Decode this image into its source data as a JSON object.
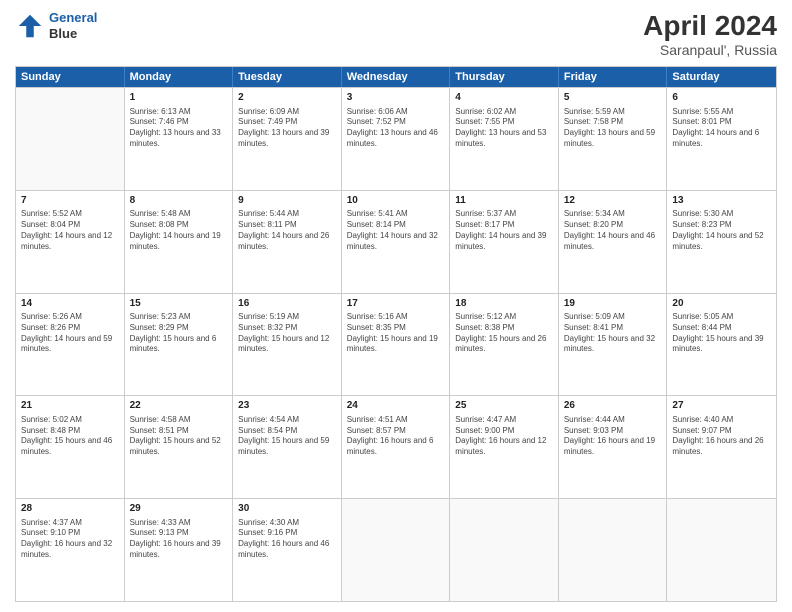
{
  "header": {
    "logo_line1": "General",
    "logo_line2": "Blue",
    "title": "April 2024",
    "location": "Saranpaul', Russia"
  },
  "weekdays": [
    "Sunday",
    "Monday",
    "Tuesday",
    "Wednesday",
    "Thursday",
    "Friday",
    "Saturday"
  ],
  "weeks": [
    [
      {
        "day": "",
        "sunrise": "",
        "sunset": "",
        "daylight": ""
      },
      {
        "day": "1",
        "sunrise": "Sunrise: 6:13 AM",
        "sunset": "Sunset: 7:46 PM",
        "daylight": "Daylight: 13 hours and 33 minutes."
      },
      {
        "day": "2",
        "sunrise": "Sunrise: 6:09 AM",
        "sunset": "Sunset: 7:49 PM",
        "daylight": "Daylight: 13 hours and 39 minutes."
      },
      {
        "day": "3",
        "sunrise": "Sunrise: 6:06 AM",
        "sunset": "Sunset: 7:52 PM",
        "daylight": "Daylight: 13 hours and 46 minutes."
      },
      {
        "day": "4",
        "sunrise": "Sunrise: 6:02 AM",
        "sunset": "Sunset: 7:55 PM",
        "daylight": "Daylight: 13 hours and 53 minutes."
      },
      {
        "day": "5",
        "sunrise": "Sunrise: 5:59 AM",
        "sunset": "Sunset: 7:58 PM",
        "daylight": "Daylight: 13 hours and 59 minutes."
      },
      {
        "day": "6",
        "sunrise": "Sunrise: 5:55 AM",
        "sunset": "Sunset: 8:01 PM",
        "daylight": "Daylight: 14 hours and 6 minutes."
      }
    ],
    [
      {
        "day": "7",
        "sunrise": "Sunrise: 5:52 AM",
        "sunset": "Sunset: 8:04 PM",
        "daylight": "Daylight: 14 hours and 12 minutes."
      },
      {
        "day": "8",
        "sunrise": "Sunrise: 5:48 AM",
        "sunset": "Sunset: 8:08 PM",
        "daylight": "Daylight: 14 hours and 19 minutes."
      },
      {
        "day": "9",
        "sunrise": "Sunrise: 5:44 AM",
        "sunset": "Sunset: 8:11 PM",
        "daylight": "Daylight: 14 hours and 26 minutes."
      },
      {
        "day": "10",
        "sunrise": "Sunrise: 5:41 AM",
        "sunset": "Sunset: 8:14 PM",
        "daylight": "Daylight: 14 hours and 32 minutes."
      },
      {
        "day": "11",
        "sunrise": "Sunrise: 5:37 AM",
        "sunset": "Sunset: 8:17 PM",
        "daylight": "Daylight: 14 hours and 39 minutes."
      },
      {
        "day": "12",
        "sunrise": "Sunrise: 5:34 AM",
        "sunset": "Sunset: 8:20 PM",
        "daylight": "Daylight: 14 hours and 46 minutes."
      },
      {
        "day": "13",
        "sunrise": "Sunrise: 5:30 AM",
        "sunset": "Sunset: 8:23 PM",
        "daylight": "Daylight: 14 hours and 52 minutes."
      }
    ],
    [
      {
        "day": "14",
        "sunrise": "Sunrise: 5:26 AM",
        "sunset": "Sunset: 8:26 PM",
        "daylight": "Daylight: 14 hours and 59 minutes."
      },
      {
        "day": "15",
        "sunrise": "Sunrise: 5:23 AM",
        "sunset": "Sunset: 8:29 PM",
        "daylight": "Daylight: 15 hours and 6 minutes."
      },
      {
        "day": "16",
        "sunrise": "Sunrise: 5:19 AM",
        "sunset": "Sunset: 8:32 PM",
        "daylight": "Daylight: 15 hours and 12 minutes."
      },
      {
        "day": "17",
        "sunrise": "Sunrise: 5:16 AM",
        "sunset": "Sunset: 8:35 PM",
        "daylight": "Daylight: 15 hours and 19 minutes."
      },
      {
        "day": "18",
        "sunrise": "Sunrise: 5:12 AM",
        "sunset": "Sunset: 8:38 PM",
        "daylight": "Daylight: 15 hours and 26 minutes."
      },
      {
        "day": "19",
        "sunrise": "Sunrise: 5:09 AM",
        "sunset": "Sunset: 8:41 PM",
        "daylight": "Daylight: 15 hours and 32 minutes."
      },
      {
        "day": "20",
        "sunrise": "Sunrise: 5:05 AM",
        "sunset": "Sunset: 8:44 PM",
        "daylight": "Daylight: 15 hours and 39 minutes."
      }
    ],
    [
      {
        "day": "21",
        "sunrise": "Sunrise: 5:02 AM",
        "sunset": "Sunset: 8:48 PM",
        "daylight": "Daylight: 15 hours and 46 minutes."
      },
      {
        "day": "22",
        "sunrise": "Sunrise: 4:58 AM",
        "sunset": "Sunset: 8:51 PM",
        "daylight": "Daylight: 15 hours and 52 minutes."
      },
      {
        "day": "23",
        "sunrise": "Sunrise: 4:54 AM",
        "sunset": "Sunset: 8:54 PM",
        "daylight": "Daylight: 15 hours and 59 minutes."
      },
      {
        "day": "24",
        "sunrise": "Sunrise: 4:51 AM",
        "sunset": "Sunset: 8:57 PM",
        "daylight": "Daylight: 16 hours and 6 minutes."
      },
      {
        "day": "25",
        "sunrise": "Sunrise: 4:47 AM",
        "sunset": "Sunset: 9:00 PM",
        "daylight": "Daylight: 16 hours and 12 minutes."
      },
      {
        "day": "26",
        "sunrise": "Sunrise: 4:44 AM",
        "sunset": "Sunset: 9:03 PM",
        "daylight": "Daylight: 16 hours and 19 minutes."
      },
      {
        "day": "27",
        "sunrise": "Sunrise: 4:40 AM",
        "sunset": "Sunset: 9:07 PM",
        "daylight": "Daylight: 16 hours and 26 minutes."
      }
    ],
    [
      {
        "day": "28",
        "sunrise": "Sunrise: 4:37 AM",
        "sunset": "Sunset: 9:10 PM",
        "daylight": "Daylight: 16 hours and 32 minutes."
      },
      {
        "day": "29",
        "sunrise": "Sunrise: 4:33 AM",
        "sunset": "Sunset: 9:13 PM",
        "daylight": "Daylight: 16 hours and 39 minutes."
      },
      {
        "day": "30",
        "sunrise": "Sunrise: 4:30 AM",
        "sunset": "Sunset: 9:16 PM",
        "daylight": "Daylight: 16 hours and 46 minutes."
      },
      {
        "day": "",
        "sunrise": "",
        "sunset": "",
        "daylight": ""
      },
      {
        "day": "",
        "sunrise": "",
        "sunset": "",
        "daylight": ""
      },
      {
        "day": "",
        "sunrise": "",
        "sunset": "",
        "daylight": ""
      },
      {
        "day": "",
        "sunrise": "",
        "sunset": "",
        "daylight": ""
      }
    ]
  ]
}
